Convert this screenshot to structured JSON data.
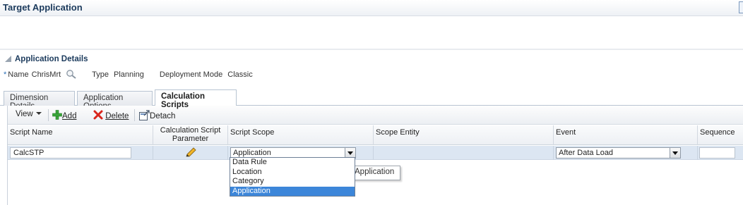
{
  "header": {
    "title": "Target Application"
  },
  "details": {
    "section_title": "Application Details",
    "required_mark": "*",
    "name_label": "Name",
    "name_value": "ChrisMrt",
    "type_label": "Type",
    "type_value": "Planning",
    "deployment_label": "Deployment Mode",
    "deployment_value": "Classic"
  },
  "tabs": [
    {
      "label": "Dimension Details",
      "active": false
    },
    {
      "label": "Application Options",
      "active": false
    },
    {
      "label": "Calculation Scripts",
      "active": true
    }
  ],
  "toolbar": {
    "view_label": "View",
    "add_label": "Add",
    "delete_label": "Delete",
    "detach_label": "Detach"
  },
  "table": {
    "columns": [
      "Script Name",
      "Calculation Script Parameter",
      "Script Scope",
      "Scope Entity",
      "Event",
      "Sequence"
    ],
    "rows": [
      {
        "script_name": "CalcSTP",
        "script_scope": "Application",
        "scope_entity": "",
        "event": "After Data Load",
        "sequence": ""
      }
    ]
  },
  "scope_dropdown": {
    "options": [
      "Data Rule",
      "Location",
      "Category",
      "Application"
    ],
    "selected": "Application"
  },
  "tooltip": {
    "text": "Application"
  },
  "colors": {
    "title": "#1b3a5c",
    "selected_row": "#dce6f2",
    "selected_option": "#3c86d9",
    "add_icon": "#3aa63a",
    "delete_icon": "#d9261c"
  }
}
